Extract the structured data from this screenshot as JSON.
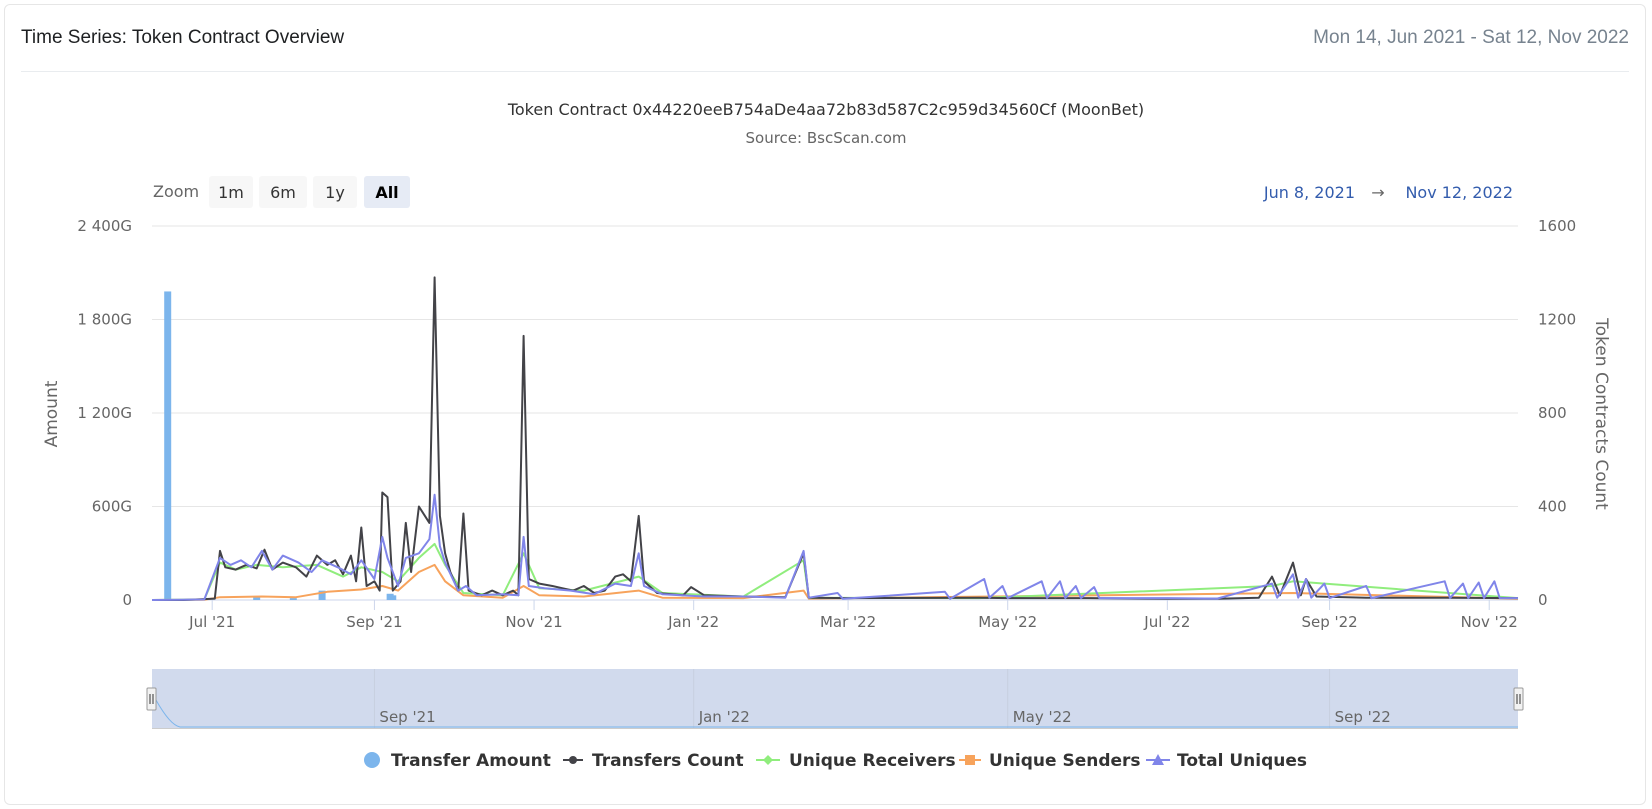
{
  "header": {
    "title": "Time Series: Token Contract Overview",
    "date_range": "Mon 14, Jun 2021 - Sat 12, Nov 2022"
  },
  "chart_data": {
    "type": "line",
    "title": "Token Contract 0x44220eeB754aDe4aa72b83d587C2c959d34560Cf (MoonBet)",
    "subtitle": "Source: BscScan.com",
    "range_selector": {
      "zoom_label": "Zoom",
      "buttons": [
        "1m",
        "6m",
        "1y",
        "All"
      ],
      "selected": "All",
      "from": "Jun 8, 2021",
      "arrow": "→",
      "to": "Nov 12, 2022"
    },
    "x_axis": {
      "type": "date",
      "min": "2021-06-08",
      "max": "2022-11-12",
      "ticks": [
        {
          "date": "2021-07-01",
          "label": "Jul '21"
        },
        {
          "date": "2021-09-01",
          "label": "Sep '21"
        },
        {
          "date": "2021-11-01",
          "label": "Nov '21"
        },
        {
          "date": "2022-01-01",
          "label": "Jan '22"
        },
        {
          "date": "2022-03-01",
          "label": "Mar '22"
        },
        {
          "date": "2022-05-01",
          "label": "May '22"
        },
        {
          "date": "2022-07-01",
          "label": "Jul '22"
        },
        {
          "date": "2022-09-01",
          "label": "Sep '22"
        },
        {
          "date": "2022-11-01",
          "label": "Nov '22"
        }
      ]
    },
    "y_left": {
      "label": "Amount",
      "min": 0,
      "max": 2400,
      "unit": "G",
      "ticks": [
        {
          "value": 0,
          "label": "0"
        },
        {
          "value": 600,
          "label": "600G"
        },
        {
          "value": 1200,
          "label": "1 200G"
        },
        {
          "value": 1800,
          "label": "1 800G"
        },
        {
          "value": 2400,
          "label": "2 400G"
        }
      ]
    },
    "y_right": {
      "label": "Token Contracts Count",
      "min": 0,
      "max": 1600,
      "ticks": [
        {
          "value": 0,
          "label": "0"
        },
        {
          "value": 400,
          "label": "400"
        },
        {
          "value": 800,
          "label": "800"
        },
        {
          "value": 1200,
          "label": "1200"
        },
        {
          "value": 1600,
          "label": "1600"
        }
      ]
    },
    "grid": true,
    "legend_position": "bottom",
    "navigator": {
      "ticks": [
        {
          "date": "2021-09-01",
          "label": "Sep '21"
        },
        {
          "date": "2022-01-01",
          "label": "Jan '22"
        },
        {
          "date": "2022-05-01",
          "label": "May '22"
        },
        {
          "date": "2022-09-01",
          "label": "Sep '22"
        }
      ]
    },
    "series": [
      {
        "name": "Transfer Amount",
        "type": "column",
        "axis": "left",
        "color": "#7cb5ec",
        "marker": "circle",
        "points": [
          [
            "2021-06-14",
            1980
          ],
          [
            "2021-07-18",
            18
          ],
          [
            "2021-08-01",
            12
          ],
          [
            "2021-08-12",
            60
          ],
          [
            "2021-09-07",
            40
          ],
          [
            "2021-09-08",
            30
          ]
        ]
      },
      {
        "name": "Transfers Count",
        "type": "line",
        "axis": "right",
        "color": "#434348",
        "marker": "circle",
        "points": [
          [
            "2021-06-08",
            0
          ],
          [
            "2021-06-20",
            0
          ],
          [
            "2021-06-28",
            4
          ],
          [
            "2021-07-02",
            6
          ],
          [
            "2021-07-04",
            210
          ],
          [
            "2021-07-06",
            140
          ],
          [
            "2021-07-10",
            130
          ],
          [
            "2021-07-14",
            150
          ],
          [
            "2021-07-18",
            135
          ],
          [
            "2021-07-21",
            215
          ],
          [
            "2021-07-24",
            130
          ],
          [
            "2021-07-28",
            160
          ],
          [
            "2021-08-02",
            140
          ],
          [
            "2021-08-06",
            100
          ],
          [
            "2021-08-10",
            190
          ],
          [
            "2021-08-14",
            150
          ],
          [
            "2021-08-17",
            170
          ],
          [
            "2021-08-20",
            110
          ],
          [
            "2021-08-23",
            190
          ],
          [
            "2021-08-25",
            80
          ],
          [
            "2021-08-27",
            310
          ],
          [
            "2021-08-29",
            60
          ],
          [
            "2021-09-01",
            80
          ],
          [
            "2021-09-03",
            40
          ],
          [
            "2021-09-04",
            460
          ],
          [
            "2021-09-06",
            440
          ],
          [
            "2021-09-08",
            40
          ],
          [
            "2021-09-11",
            80
          ],
          [
            "2021-09-13",
            330
          ],
          [
            "2021-09-15",
            120
          ],
          [
            "2021-09-18",
            400
          ],
          [
            "2021-09-22",
            330
          ],
          [
            "2021-09-24",
            1380
          ],
          [
            "2021-09-26",
            360
          ],
          [
            "2021-09-28",
            200
          ],
          [
            "2021-09-30",
            120
          ],
          [
            "2021-10-03",
            40
          ],
          [
            "2021-10-05",
            370
          ],
          [
            "2021-10-07",
            40
          ],
          [
            "2021-10-12",
            20
          ],
          [
            "2021-10-16",
            40
          ],
          [
            "2021-10-20",
            20
          ],
          [
            "2021-10-24",
            40
          ],
          [
            "2021-10-26",
            20
          ],
          [
            "2021-10-28",
            1130
          ],
          [
            "2021-10-30",
            90
          ],
          [
            "2021-11-03",
            70
          ],
          [
            "2021-11-08",
            60
          ],
          [
            "2021-11-12",
            50
          ],
          [
            "2021-11-16",
            40
          ],
          [
            "2021-11-20",
            60
          ],
          [
            "2021-11-24",
            30
          ],
          [
            "2021-11-28",
            40
          ],
          [
            "2021-12-02",
            100
          ],
          [
            "2021-12-05",
            110
          ],
          [
            "2021-12-08",
            80
          ],
          [
            "2021-12-11",
            360
          ],
          [
            "2021-12-13",
            80
          ],
          [
            "2021-12-18",
            30
          ],
          [
            "2021-12-28",
            20
          ],
          [
            "2021-12-31",
            55
          ],
          [
            "2022-01-05",
            20
          ],
          [
            "2022-01-20",
            15
          ],
          [
            "2022-02-05",
            12
          ],
          [
            "2022-02-12",
            200
          ],
          [
            "2022-02-14",
            10
          ],
          [
            "2022-03-01",
            8
          ],
          [
            "2022-04-20",
            10
          ],
          [
            "2022-05-01",
            8
          ],
          [
            "2022-06-01",
            8
          ],
          [
            "2022-07-01",
            5
          ],
          [
            "2022-07-20",
            5
          ],
          [
            "2022-08-05",
            10
          ],
          [
            "2022-08-10",
            100
          ],
          [
            "2022-08-13",
            20
          ],
          [
            "2022-08-18",
            160
          ],
          [
            "2022-08-21",
            20
          ],
          [
            "2022-08-23",
            90
          ],
          [
            "2022-08-27",
            15
          ],
          [
            "2022-09-15",
            10
          ],
          [
            "2022-10-15",
            10
          ],
          [
            "2022-11-12",
            8
          ]
        ]
      },
      {
        "name": "Unique Receivers",
        "type": "line",
        "axis": "right",
        "color": "#90ed7d",
        "marker": "diamond",
        "points": [
          [
            "2021-06-08",
            0
          ],
          [
            "2021-06-28",
            2
          ],
          [
            "2021-07-04",
            160
          ],
          [
            "2021-07-10",
            130
          ],
          [
            "2021-07-18",
            150
          ],
          [
            "2021-07-28",
            140
          ],
          [
            "2021-08-10",
            150
          ],
          [
            "2021-08-20",
            100
          ],
          [
            "2021-08-27",
            140
          ],
          [
            "2021-09-04",
            120
          ],
          [
            "2021-09-10",
            80
          ],
          [
            "2021-09-18",
            180
          ],
          [
            "2021-09-24",
            240
          ],
          [
            "2021-09-28",
            150
          ],
          [
            "2021-10-05",
            30
          ],
          [
            "2021-10-20",
            20
          ],
          [
            "2021-10-28",
            200
          ],
          [
            "2021-11-03",
            50
          ],
          [
            "2021-11-20",
            40
          ],
          [
            "2021-12-11",
            100
          ],
          [
            "2021-12-20",
            30
          ],
          [
            "2022-01-20",
            15
          ],
          [
            "2022-02-12",
            170
          ],
          [
            "2022-02-14",
            10
          ],
          [
            "2022-04-20",
            8
          ],
          [
            "2022-08-10",
            60
          ],
          [
            "2022-08-18",
            80
          ],
          [
            "2022-11-12",
            8
          ]
        ]
      },
      {
        "name": "Unique Senders",
        "type": "line",
        "axis": "right",
        "color": "#f7a35c",
        "marker": "square",
        "points": [
          [
            "2021-06-08",
            0
          ],
          [
            "2021-06-28",
            1
          ],
          [
            "2021-07-04",
            12
          ],
          [
            "2021-07-20",
            15
          ],
          [
            "2021-08-02",
            12
          ],
          [
            "2021-08-14",
            35
          ],
          [
            "2021-08-27",
            45
          ],
          [
            "2021-09-04",
            60
          ],
          [
            "2021-09-10",
            40
          ],
          [
            "2021-09-18",
            120
          ],
          [
            "2021-09-24",
            150
          ],
          [
            "2021-09-28",
            80
          ],
          [
            "2021-10-05",
            20
          ],
          [
            "2021-10-20",
            10
          ],
          [
            "2021-10-28",
            60
          ],
          [
            "2021-11-03",
            20
          ],
          [
            "2021-11-20",
            15
          ],
          [
            "2021-12-11",
            40
          ],
          [
            "2021-12-20",
            10
          ],
          [
            "2022-01-20",
            8
          ],
          [
            "2022-02-12",
            40
          ],
          [
            "2022-02-14",
            6
          ],
          [
            "2022-08-18",
            30
          ],
          [
            "2022-11-12",
            5
          ]
        ]
      },
      {
        "name": "Total Uniques",
        "type": "line",
        "axis": "right",
        "color": "#8085e9",
        "marker": "triangle",
        "points": [
          [
            "2021-06-08",
            0
          ],
          [
            "2021-06-28",
            2
          ],
          [
            "2021-07-04",
            180
          ],
          [
            "2021-07-08",
            150
          ],
          [
            "2021-07-12",
            170
          ],
          [
            "2021-07-16",
            140
          ],
          [
            "2021-07-20",
            210
          ],
          [
            "2021-07-24",
            130
          ],
          [
            "2021-07-28",
            190
          ],
          [
            "2021-08-03",
            160
          ],
          [
            "2021-08-08",
            120
          ],
          [
            "2021-08-12",
            170
          ],
          [
            "2021-08-18",
            140
          ],
          [
            "2021-08-23",
            110
          ],
          [
            "2021-08-27",
            170
          ],
          [
            "2021-09-01",
            90
          ],
          [
            "2021-09-04",
            270
          ],
          [
            "2021-09-06",
            180
          ],
          [
            "2021-09-10",
            60
          ],
          [
            "2021-09-13",
            180
          ],
          [
            "2021-09-18",
            200
          ],
          [
            "2021-09-22",
            260
          ],
          [
            "2021-09-24",
            450
          ],
          [
            "2021-09-26",
            230
          ],
          [
            "2021-09-28",
            160
          ],
          [
            "2021-10-03",
            40
          ],
          [
            "2021-10-06",
            60
          ],
          [
            "2021-10-10",
            20
          ],
          [
            "2021-10-20",
            25
          ],
          [
            "2021-10-26",
            20
          ],
          [
            "2021-10-28",
            270
          ],
          [
            "2021-10-30",
            60
          ],
          [
            "2021-11-05",
            50
          ],
          [
            "2021-11-15",
            40
          ],
          [
            "2021-11-24",
            25
          ],
          [
            "2021-12-02",
            70
          ],
          [
            "2021-12-08",
            60
          ],
          [
            "2021-12-11",
            200
          ],
          [
            "2021-12-13",
            60
          ],
          [
            "2021-12-20",
            25
          ],
          [
            "2022-01-05",
            15
          ],
          [
            "2022-01-20",
            15
          ],
          [
            "2022-02-05",
            10
          ],
          [
            "2022-02-12",
            210
          ],
          [
            "2022-02-14",
            10
          ],
          [
            "2022-02-25",
            30
          ],
          [
            "2022-02-27",
            5
          ],
          [
            "2022-04-07",
            35
          ],
          [
            "2022-04-09",
            5
          ],
          [
            "2022-04-22",
            90
          ],
          [
            "2022-04-24",
            10
          ],
          [
            "2022-04-29",
            60
          ],
          [
            "2022-05-01",
            8
          ],
          [
            "2022-05-14",
            80
          ],
          [
            "2022-05-16",
            8
          ],
          [
            "2022-05-21",
            80
          ],
          [
            "2022-05-23",
            8
          ],
          [
            "2022-05-27",
            60
          ],
          [
            "2022-05-29",
            8
          ],
          [
            "2022-06-03",
            55
          ],
          [
            "2022-06-05",
            8
          ],
          [
            "2022-07-01",
            8
          ],
          [
            "2022-07-20",
            6
          ],
          [
            "2022-08-10",
            70
          ],
          [
            "2022-08-12",
            10
          ],
          [
            "2022-08-18",
            110
          ],
          [
            "2022-08-20",
            10
          ],
          [
            "2022-08-23",
            90
          ],
          [
            "2022-08-25",
            10
          ],
          [
            "2022-08-30",
            70
          ],
          [
            "2022-09-01",
            8
          ],
          [
            "2022-09-15",
            60
          ],
          [
            "2022-09-17",
            8
          ],
          [
            "2022-10-15",
            80
          ],
          [
            "2022-10-17",
            8
          ],
          [
            "2022-10-22",
            70
          ],
          [
            "2022-10-24",
            8
          ],
          [
            "2022-10-28",
            75
          ],
          [
            "2022-10-30",
            8
          ],
          [
            "2022-11-03",
            80
          ],
          [
            "2022-11-05",
            8
          ],
          [
            "2022-11-12",
            8
          ]
        ]
      }
    ]
  }
}
